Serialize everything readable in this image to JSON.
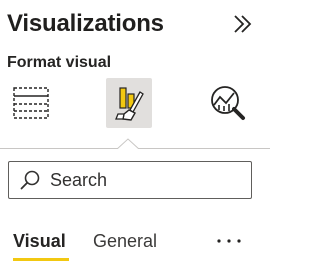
{
  "pane": {
    "title": "Visualizations",
    "collapse_icon": "double-chevron-right-icon",
    "subtitle": "Format visual"
  },
  "visual_types": [
    {
      "name": "Build visual",
      "icon": "fields-table-icon",
      "selected": false
    },
    {
      "name": "Format visual",
      "icon": "paint-brush-icon",
      "selected": true
    },
    {
      "name": "Analytics",
      "icon": "analytics-magnifier-icon",
      "selected": false
    }
  ],
  "search": {
    "placeholder": "Search",
    "value": "",
    "icon": "search-icon"
  },
  "tabs": [
    {
      "label": "Visual",
      "active": true
    },
    {
      "label": "General",
      "active": false
    }
  ],
  "more_icon": "more-ellipsis-icon",
  "colors": {
    "accent": "#f2c811",
    "selected_bg": "#e1dfdd",
    "text": "#252423",
    "border": "#605e5c"
  }
}
